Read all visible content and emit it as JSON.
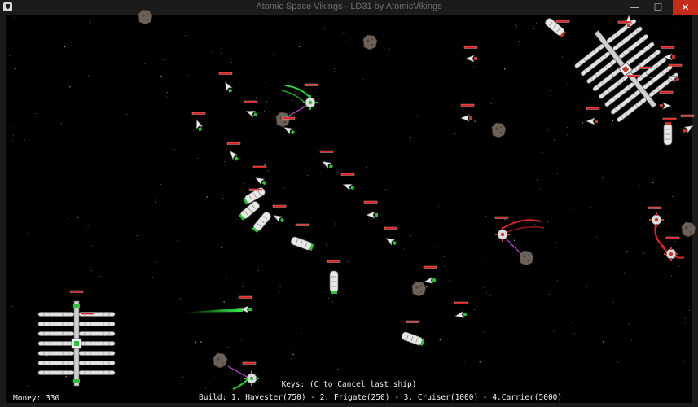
{
  "window": {
    "title": "Atomic Space Vikings - LD31 by AtomicVikings",
    "minimize_glyph": "—",
    "maximize_glyph": "☐",
    "close_glyph": "✕"
  },
  "hud": {
    "money_label": "Money:",
    "money_value": "330",
    "keys_text": "Keys: (C to Cancel last ship)",
    "build_text": "Build: 1. Havester(750) - 2. Frigate(250) - 3. Cruiser(1000) - 4.Carrier(5000)"
  },
  "colors": {
    "player": "#2fbf3a",
    "enemy": "#d21f1f",
    "hull": "#e6e6e6",
    "asteroid": "#6e6158",
    "health_bar": "#d82020"
  },
  "icons": {
    "app": "viking-helmet-icon",
    "minimize": "minimize-icon",
    "maximize": "maximize-icon",
    "close": "close-icon"
  }
}
